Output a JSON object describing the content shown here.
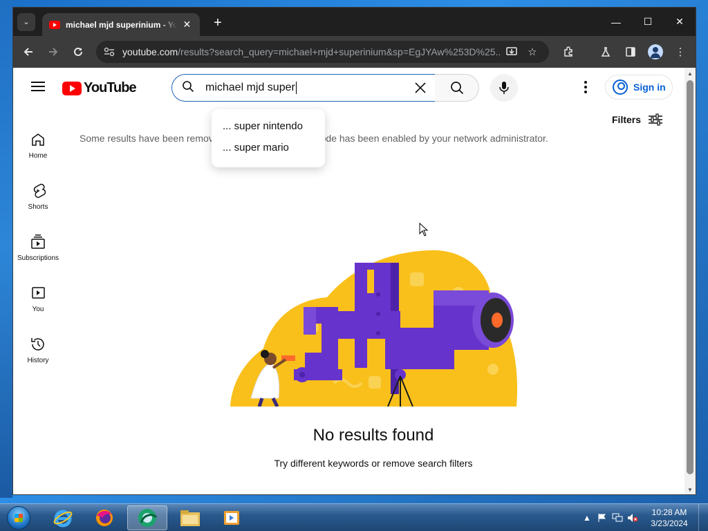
{
  "browser": {
    "tab_title": "michael mjd superinium - YouTube",
    "url_host": "youtube.com",
    "url_path": "/results?search_query=michael+mjd+superinium&sp=EgJYAw%253D%25...",
    "new_tab_symbol": "+",
    "window_controls": {
      "minimize": "—",
      "maximize": "☐",
      "close": "✕"
    }
  },
  "youtube": {
    "logo_text": "YouTube",
    "search_value": "michael mjd super",
    "suggestions": [
      "... super nintendo",
      "... super mario"
    ],
    "sign_in_label": "Sign in",
    "filters_label": "Filters",
    "notice_text": "Some results have been removed because Restricted Mode has been enabled by your network administrator.",
    "guide": [
      {
        "label": "Home",
        "icon": "home-icon"
      },
      {
        "label": "Shorts",
        "icon": "shorts-icon"
      },
      {
        "label": "Subscriptions",
        "icon": "subscriptions-icon"
      },
      {
        "label": "You",
        "icon": "you-icon"
      },
      {
        "label": "History",
        "icon": "history-icon"
      }
    ],
    "no_results_title": "No results found",
    "no_results_subtitle": "Try different keywords or remove search filters"
  },
  "taskbar": {
    "apps": [
      "internet-explorer",
      "firefox",
      "chrome-app",
      "file-explorer",
      "media-player"
    ],
    "clock_time": "10:28 AM",
    "clock_date": "3/23/2024"
  },
  "colors": {
    "youtube_red": "#ff0000",
    "link_blue": "#065fd4",
    "illus_yellow": "#f9c01c",
    "illus_purple": "#6633cc"
  }
}
